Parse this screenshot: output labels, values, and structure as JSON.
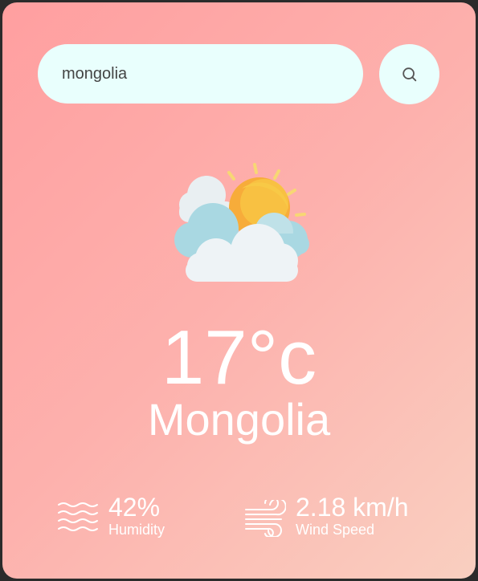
{
  "search": {
    "value": "mongolia",
    "placeholder": "",
    "button_icon": "search-icon"
  },
  "weather": {
    "icon": "sun-behind-clouds-icon",
    "temperature": "17°c",
    "city": "Mongolia"
  },
  "details": {
    "humidity": {
      "icon": "humidity-waves-icon",
      "value": "42%",
      "label": "Humidity"
    },
    "wind": {
      "icon": "wind-icon",
      "value": "2.18 km/h",
      "label": "Wind Speed"
    }
  },
  "colors": {
    "gradient_start": "#ff9fa0",
    "gradient_end": "#f9cfc0",
    "input_bg": "#e9fffd",
    "text": "#ffffff"
  }
}
